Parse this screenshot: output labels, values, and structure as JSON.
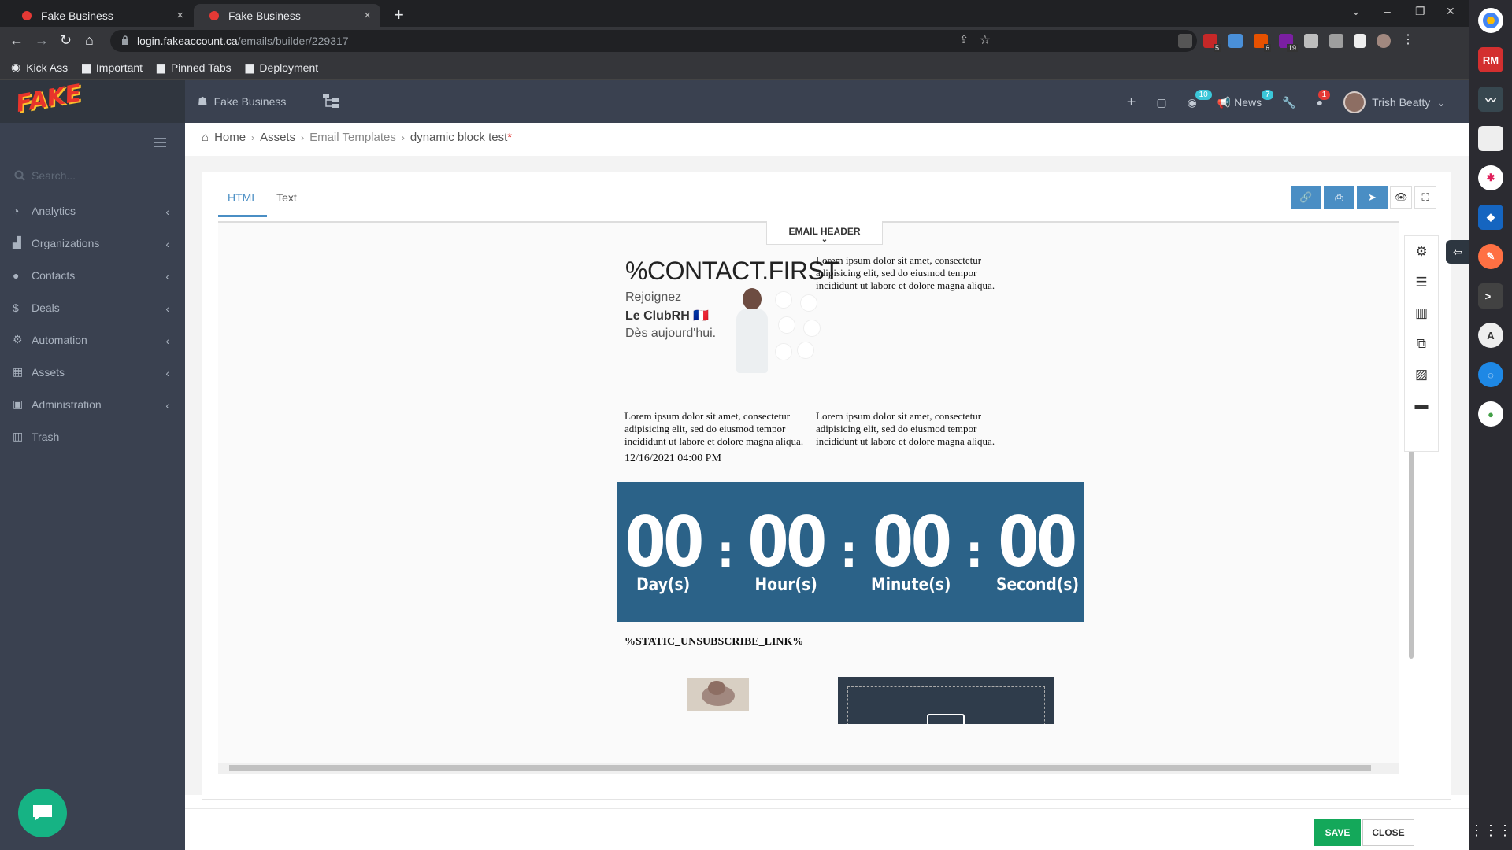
{
  "browser": {
    "tabs": [
      {
        "title": "Fake Business",
        "close": "×"
      },
      {
        "title": "Fake Business",
        "close": "×"
      }
    ],
    "new_tab": "+",
    "url_domain": "login.fakeaccount.ca",
    "url_path": "/emails/builder/229317",
    "bookmarks": [
      "Kick Ass",
      "Important",
      "Pinned Tabs",
      "Deployment"
    ],
    "extension_badges": [
      "5",
      "6",
      "19"
    ]
  },
  "dock": {
    "rm_label": "RM"
  },
  "app": {
    "logo_text": "FAKE",
    "company_name": "Fake Business",
    "search_placeholder": "Search...",
    "nav_items": [
      "Analytics",
      "Organizations",
      "Contacts",
      "Deals",
      "Automation",
      "Assets",
      "Administration",
      "Trash"
    ],
    "topbar": {
      "notifications_count": "10",
      "news_label": "News",
      "news_count": "7",
      "alerts_count": "1",
      "user_name": "Trish Beatty"
    }
  },
  "breadcrumb": {
    "home": "Home",
    "assets": "Assets",
    "email_templates": "Email Templates",
    "current": "dynamic block test",
    "required_mark": "*"
  },
  "builder": {
    "tabs": [
      "HTML",
      "Text"
    ],
    "email_header": "EMAIL HEADER",
    "banner": {
      "contact_token": "%CONTACT.FIRST",
      "line1": "Rejoignez",
      "line2": "Le ClubRH 🇫🇷",
      "line3": "Dès aujourd'hui."
    },
    "lorem": "Lorem ipsum dolor sit amet, consectetur adipisicing elit, sed do eiusmod tempor incididunt ut labore et dolore magna aliqua.",
    "datetime": "12/16/2021 04:00 PM",
    "countdown": {
      "days": "00",
      "hours": "00",
      "minutes": "00",
      "seconds": "00",
      "days_label": "Day(s)",
      "hours_label": "Hour(s)",
      "minutes_label": "Minute(s)",
      "seconds_label": "Second(s)",
      "separator": ":"
    },
    "unsubscribe": "%STATIC_UNSUBSCRIBE_LINK%"
  },
  "footer": {
    "save": "SAVE",
    "close": "CLOSE"
  },
  "colors": {
    "sidebar": "#3a4150",
    "accent": "#4a8ec4",
    "countdown_bg": "#2b6288",
    "save": "#14a85a"
  }
}
